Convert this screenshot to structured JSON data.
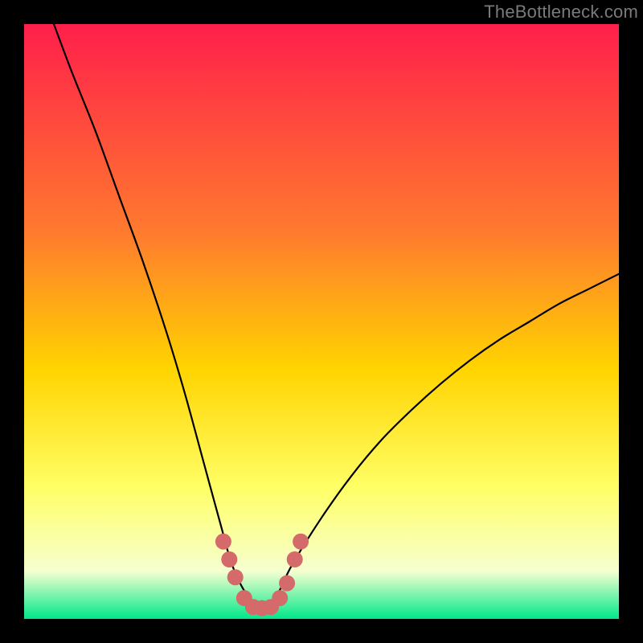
{
  "watermark": "TheBottleneck.com",
  "colors": {
    "frame": "#000000",
    "gradient_top": "#ff1f4b",
    "gradient_mid_upper": "#ff7a2e",
    "gradient_mid": "#ffd400",
    "gradient_lower": "#ffff66",
    "gradient_pale": "#f6ffd0",
    "gradient_bottom": "#00e88a",
    "curve": "#000000",
    "marker_fill": "#d46a6a",
    "marker_stroke": "#c65555"
  },
  "chart_data": {
    "type": "line",
    "title": "",
    "xlabel": "",
    "ylabel": "",
    "xlim": [
      0,
      100
    ],
    "ylim": [
      0,
      100
    ],
    "series": [
      {
        "name": "bottleneck-curve",
        "x": [
          5,
          8,
          12,
          16,
          20,
          24,
          27,
          30,
          33,
          35,
          37.5,
          40,
          42.5,
          45,
          50,
          55,
          60,
          65,
          70,
          75,
          80,
          85,
          90,
          95,
          100
        ],
        "y": [
          100,
          92,
          82,
          71,
          60,
          48,
          38,
          27,
          16,
          9,
          4,
          2,
          4,
          9,
          17,
          24,
          30,
          35,
          39.5,
          43.5,
          47,
          50,
          53,
          55.5,
          58
        ]
      }
    ],
    "markers": {
      "name": "highlight-cluster",
      "points": [
        {
          "x": 33.5,
          "y": 13
        },
        {
          "x": 34.5,
          "y": 10
        },
        {
          "x": 35.5,
          "y": 7
        },
        {
          "x": 37,
          "y": 3.5
        },
        {
          "x": 38.5,
          "y": 2
        },
        {
          "x": 40,
          "y": 1.8
        },
        {
          "x": 41.5,
          "y": 2
        },
        {
          "x": 43,
          "y": 3.5
        },
        {
          "x": 44.2,
          "y": 6
        },
        {
          "x": 45.5,
          "y": 10
        },
        {
          "x": 46.5,
          "y": 13
        }
      ]
    }
  }
}
